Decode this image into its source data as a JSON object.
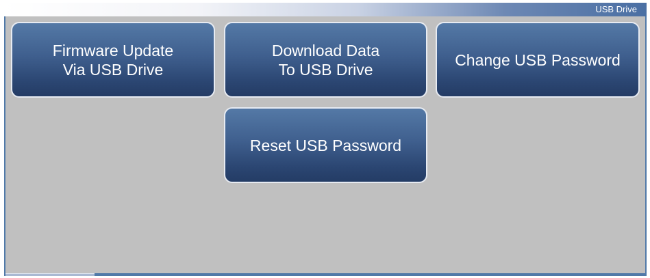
{
  "header": {
    "title": "USB Drive"
  },
  "buttons": {
    "firmware_update": {
      "line1": "Firmware Update",
      "line2": "Via USB Drive"
    },
    "download_data": {
      "line1": "Download Data",
      "line2": "To USB Drive"
    },
    "change_password": {
      "label": "Change USB Password"
    },
    "reset_password": {
      "label": "Reset USB Password"
    }
  },
  "colors": {
    "frame": "#5079a8",
    "content_background": "#c0c0c0",
    "button_gradient_top": "#5479a6",
    "button_gradient_bottom": "#243c65",
    "button_border": "#e7ebf2",
    "text": "#ffffff"
  }
}
